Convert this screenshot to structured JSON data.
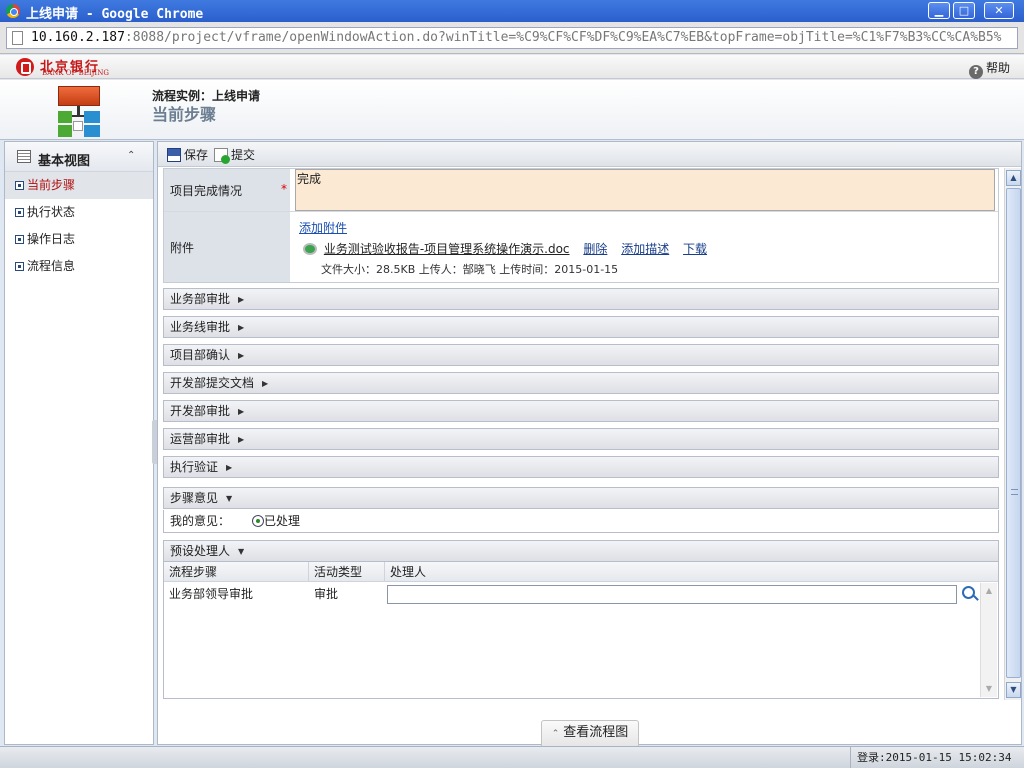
{
  "window": {
    "title": "上线申请 - Google Chrome",
    "controls": {
      "minimize": "▁",
      "maximize": "□",
      "close": "✕"
    }
  },
  "address": {
    "host": "10.160.2.187",
    "rest": ":8088/project/vframe/openWindowAction.do?winTitle=%C9%CF%CF%DF%C9%EA%C7%EB&topFrame=objTitle=%C1%F7%B3%CC%CA%B5%"
  },
  "brand": {
    "name_cn": "北京银行",
    "name_en": "BANK OF BEIJING"
  },
  "help": {
    "label": "帮助",
    "icon": "question-icon"
  },
  "header": {
    "instance": "流程实例：上线申请",
    "step_title": "当前步骤"
  },
  "sidebar": {
    "title": "基本视图",
    "collapse_glyph": "⌃",
    "items": [
      {
        "label": "当前步骤",
        "active": true
      },
      {
        "label": "执行状态",
        "active": false
      },
      {
        "label": "操作日志",
        "active": false
      },
      {
        "label": "流程信息",
        "active": false
      }
    ]
  },
  "toolbar": {
    "save": "保存",
    "submit": "提交"
  },
  "form": {
    "completion": {
      "label": "项目完成情况",
      "required_mark": "*",
      "value": "完成"
    },
    "attachment": {
      "label": "附件",
      "add_link": "添加附件",
      "file_name": "业务测试验收报告-项目管理系统操作演示.doc",
      "delete": "删除",
      "add_desc": "添加描述",
      "download": "下载",
      "meta": "文件大小：28.5KB 上传人：郜晓飞 上传时间：2015-01-15"
    }
  },
  "sections": [
    {
      "label": "业务部审批",
      "arrow": "▶"
    },
    {
      "label": "业务线审批",
      "arrow": "▶"
    },
    {
      "label": "项目部确认",
      "arrow": "▶"
    },
    {
      "label": "开发部提交文档",
      "arrow": "▶"
    },
    {
      "label": "开发部审批",
      "arrow": "▶"
    },
    {
      "label": "运营部审批",
      "arrow": "▶"
    },
    {
      "label": "执行验证",
      "arrow": "▶"
    }
  ],
  "opinion": {
    "label": "步骤意见",
    "arrow": "▼",
    "my_opinion_label": "我的意见：",
    "choice": "已处理"
  },
  "preset": {
    "label": "预设处理人",
    "arrow": "▼",
    "columns": [
      "流程步骤",
      "活动类型",
      "处理人"
    ],
    "rows": [
      {
        "step": "业务部领导审批",
        "type": "审批",
        "handler": ""
      }
    ]
  },
  "flow_button": {
    "label": "查看流程图",
    "glyph": "⌃"
  },
  "status": {
    "login_label": "登录:",
    "login_time": "2015-01-15 15:02:34"
  },
  "scroll": {
    "up": "▲",
    "down": "▼"
  }
}
